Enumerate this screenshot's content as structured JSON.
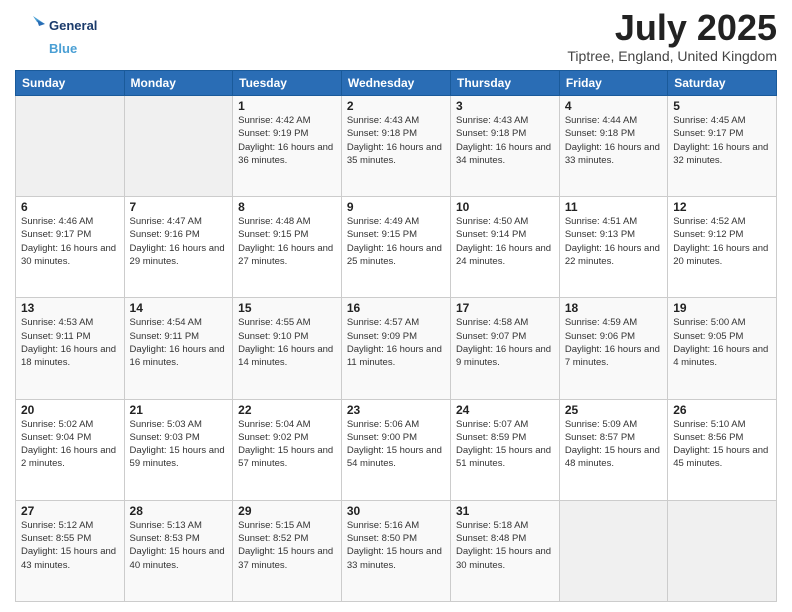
{
  "logo": {
    "line1": "General",
    "line2": "Blue"
  },
  "title": "July 2025",
  "subtitle": "Tiptree, England, United Kingdom",
  "days_of_week": [
    "Sunday",
    "Monday",
    "Tuesday",
    "Wednesday",
    "Thursday",
    "Friday",
    "Saturday"
  ],
  "weeks": [
    [
      {
        "day": "",
        "info": ""
      },
      {
        "day": "",
        "info": ""
      },
      {
        "day": "1",
        "info": "Sunrise: 4:42 AM\nSunset: 9:19 PM\nDaylight: 16 hours and 36 minutes."
      },
      {
        "day": "2",
        "info": "Sunrise: 4:43 AM\nSunset: 9:18 PM\nDaylight: 16 hours and 35 minutes."
      },
      {
        "day": "3",
        "info": "Sunrise: 4:43 AM\nSunset: 9:18 PM\nDaylight: 16 hours and 34 minutes."
      },
      {
        "day": "4",
        "info": "Sunrise: 4:44 AM\nSunset: 9:18 PM\nDaylight: 16 hours and 33 minutes."
      },
      {
        "day": "5",
        "info": "Sunrise: 4:45 AM\nSunset: 9:17 PM\nDaylight: 16 hours and 32 minutes."
      }
    ],
    [
      {
        "day": "6",
        "info": "Sunrise: 4:46 AM\nSunset: 9:17 PM\nDaylight: 16 hours and 30 minutes."
      },
      {
        "day": "7",
        "info": "Sunrise: 4:47 AM\nSunset: 9:16 PM\nDaylight: 16 hours and 29 minutes."
      },
      {
        "day": "8",
        "info": "Sunrise: 4:48 AM\nSunset: 9:15 PM\nDaylight: 16 hours and 27 minutes."
      },
      {
        "day": "9",
        "info": "Sunrise: 4:49 AM\nSunset: 9:15 PM\nDaylight: 16 hours and 25 minutes."
      },
      {
        "day": "10",
        "info": "Sunrise: 4:50 AM\nSunset: 9:14 PM\nDaylight: 16 hours and 24 minutes."
      },
      {
        "day": "11",
        "info": "Sunrise: 4:51 AM\nSunset: 9:13 PM\nDaylight: 16 hours and 22 minutes."
      },
      {
        "day": "12",
        "info": "Sunrise: 4:52 AM\nSunset: 9:12 PM\nDaylight: 16 hours and 20 minutes."
      }
    ],
    [
      {
        "day": "13",
        "info": "Sunrise: 4:53 AM\nSunset: 9:11 PM\nDaylight: 16 hours and 18 minutes."
      },
      {
        "day": "14",
        "info": "Sunrise: 4:54 AM\nSunset: 9:11 PM\nDaylight: 16 hours and 16 minutes."
      },
      {
        "day": "15",
        "info": "Sunrise: 4:55 AM\nSunset: 9:10 PM\nDaylight: 16 hours and 14 minutes."
      },
      {
        "day": "16",
        "info": "Sunrise: 4:57 AM\nSunset: 9:09 PM\nDaylight: 16 hours and 11 minutes."
      },
      {
        "day": "17",
        "info": "Sunrise: 4:58 AM\nSunset: 9:07 PM\nDaylight: 16 hours and 9 minutes."
      },
      {
        "day": "18",
        "info": "Sunrise: 4:59 AM\nSunset: 9:06 PM\nDaylight: 16 hours and 7 minutes."
      },
      {
        "day": "19",
        "info": "Sunrise: 5:00 AM\nSunset: 9:05 PM\nDaylight: 16 hours and 4 minutes."
      }
    ],
    [
      {
        "day": "20",
        "info": "Sunrise: 5:02 AM\nSunset: 9:04 PM\nDaylight: 16 hours and 2 minutes."
      },
      {
        "day": "21",
        "info": "Sunrise: 5:03 AM\nSunset: 9:03 PM\nDaylight: 15 hours and 59 minutes."
      },
      {
        "day": "22",
        "info": "Sunrise: 5:04 AM\nSunset: 9:02 PM\nDaylight: 15 hours and 57 minutes."
      },
      {
        "day": "23",
        "info": "Sunrise: 5:06 AM\nSunset: 9:00 PM\nDaylight: 15 hours and 54 minutes."
      },
      {
        "day": "24",
        "info": "Sunrise: 5:07 AM\nSunset: 8:59 PM\nDaylight: 15 hours and 51 minutes."
      },
      {
        "day": "25",
        "info": "Sunrise: 5:09 AM\nSunset: 8:57 PM\nDaylight: 15 hours and 48 minutes."
      },
      {
        "day": "26",
        "info": "Sunrise: 5:10 AM\nSunset: 8:56 PM\nDaylight: 15 hours and 45 minutes."
      }
    ],
    [
      {
        "day": "27",
        "info": "Sunrise: 5:12 AM\nSunset: 8:55 PM\nDaylight: 15 hours and 43 minutes."
      },
      {
        "day": "28",
        "info": "Sunrise: 5:13 AM\nSunset: 8:53 PM\nDaylight: 15 hours and 40 minutes."
      },
      {
        "day": "29",
        "info": "Sunrise: 5:15 AM\nSunset: 8:52 PM\nDaylight: 15 hours and 37 minutes."
      },
      {
        "day": "30",
        "info": "Sunrise: 5:16 AM\nSunset: 8:50 PM\nDaylight: 15 hours and 33 minutes."
      },
      {
        "day": "31",
        "info": "Sunrise: 5:18 AM\nSunset: 8:48 PM\nDaylight: 15 hours and 30 minutes."
      },
      {
        "day": "",
        "info": ""
      },
      {
        "day": "",
        "info": ""
      }
    ]
  ]
}
